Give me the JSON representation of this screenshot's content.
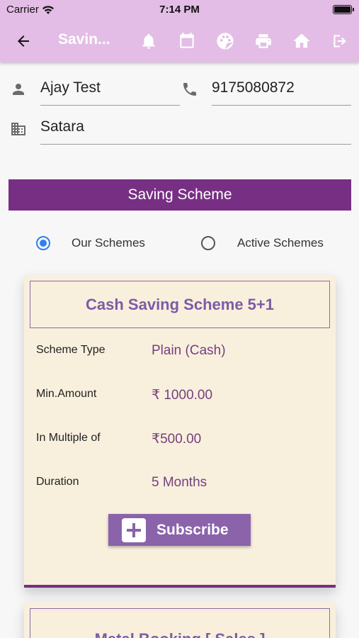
{
  "status_bar": {
    "carrier": "Carrier",
    "time": "7:14 PM"
  },
  "appbar": {
    "title": "Savin...",
    "icons": [
      "bell-icon",
      "calendar-icon",
      "palette-icon",
      "printer-icon",
      "home-icon",
      "logout-icon"
    ],
    "background": "#e3bde5"
  },
  "customer": {
    "name": "Ajay Test",
    "phone": "9175080872",
    "city": "Satara"
  },
  "section": {
    "title": "Saving Scheme",
    "color": "#772f83"
  },
  "scheme_filter": {
    "options": [
      "Our Schemes",
      "Active Schemes"
    ],
    "selected": "Our Schemes"
  },
  "schemes": [
    {
      "title": "Cash Saving Scheme 5+1",
      "details": [
        {
          "label": "Scheme Type",
          "value": "Plain (Cash)"
        },
        {
          "label": "Min.Amount",
          "value": "₹ 1000.00"
        },
        {
          "label": "In Multiple of",
          "value": "₹500.00"
        },
        {
          "label": "Duration",
          "value": "5 Months"
        }
      ],
      "action_label": "Subscribe"
    },
    {
      "title": "Metal Booking [ Sales ]"
    }
  ]
}
